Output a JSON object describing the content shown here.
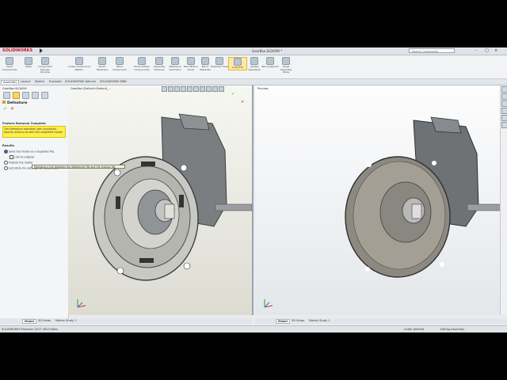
{
  "app": {
    "brand": "SOLIDWORKS",
    "document_title": "GearBox.SLDASM *",
    "search_placeholder": "Search Commands"
  },
  "ribbon": {
    "buttons": [
      {
        "label": "Insert Components"
      },
      {
        "label": "Mate"
      },
      {
        "label": "Component Preview Window"
      },
      {
        "label": "Linear Component Pattern"
      },
      {
        "label": "Smart Fasteners"
      },
      {
        "label": "Move Component"
      },
      {
        "label": "Show Hidden Components"
      },
      {
        "label": "Assembly Features"
      },
      {
        "label": "Reference Geometry"
      },
      {
        "label": "New Motion Study"
      },
      {
        "label": "Bill of Materials"
      },
      {
        "label": "Exploded View"
      },
      {
        "label": "Instant3D"
      },
      {
        "label": "Update Speedpak"
      },
      {
        "label": "Take Snapshot"
      },
      {
        "label": "Large Assembly Mode"
      }
    ]
  },
  "command_tabs": [
    "Assembly",
    "Layout",
    "Sketch",
    "Evaluate",
    "SOLIDWORKS Add-Ins",
    "SOLIDWORKS MBD"
  ],
  "property_manager": {
    "tree_label": "GearBox.SLDASM",
    "title": "Defeature",
    "message_section": "Feature Removal Complete",
    "message": "The Defeature operation was successful. Specify what to do with the simplified model.",
    "results_section": "Results",
    "options": [
      {
        "label": "Save the model as a separate file.",
        "checked": true
      },
      {
        "label": "Link to original",
        "checked": false
      },
      {
        "label": "Publish the model",
        "checked": false
      },
      {
        "label": "Just store my settings for future use.",
        "checked": false
      }
    ],
    "tooltip": "Maintains a link between the defeatured file and the original file"
  },
  "left_view": {
    "tree": "GearBox (Default<Default_..."
  },
  "right_view": {
    "tree": "Preview"
  },
  "bottom_tabs_left": [
    "Model",
    "3D Views",
    "Motion Study 1"
  ],
  "bottom_tabs_right": [
    "Model",
    "3D Views",
    "Motion Study 1"
  ],
  "status": {
    "edition": "SOLIDWORKS Premium 2017 x64 Edition",
    "config": "Under Defined",
    "mode": "Editing Assembly"
  }
}
